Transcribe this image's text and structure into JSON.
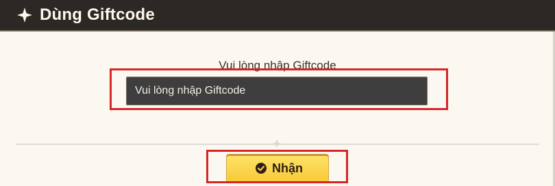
{
  "header": {
    "title": "Dùng Giftcode",
    "icon": "sparkle-star-icon"
  },
  "form": {
    "prompt": "Vui lòng nhập Giftcode",
    "input_value": "Vui lòng nhập Giftcode"
  },
  "action": {
    "button_label": "Nhận",
    "button_icon": "check-circle-icon"
  },
  "colors": {
    "header_bg": "#2b2826",
    "panel_bg": "#fbf8f1",
    "input_bg": "#3f3e3e",
    "button_bg": "#f7ca38",
    "highlight_border": "#d52525"
  }
}
